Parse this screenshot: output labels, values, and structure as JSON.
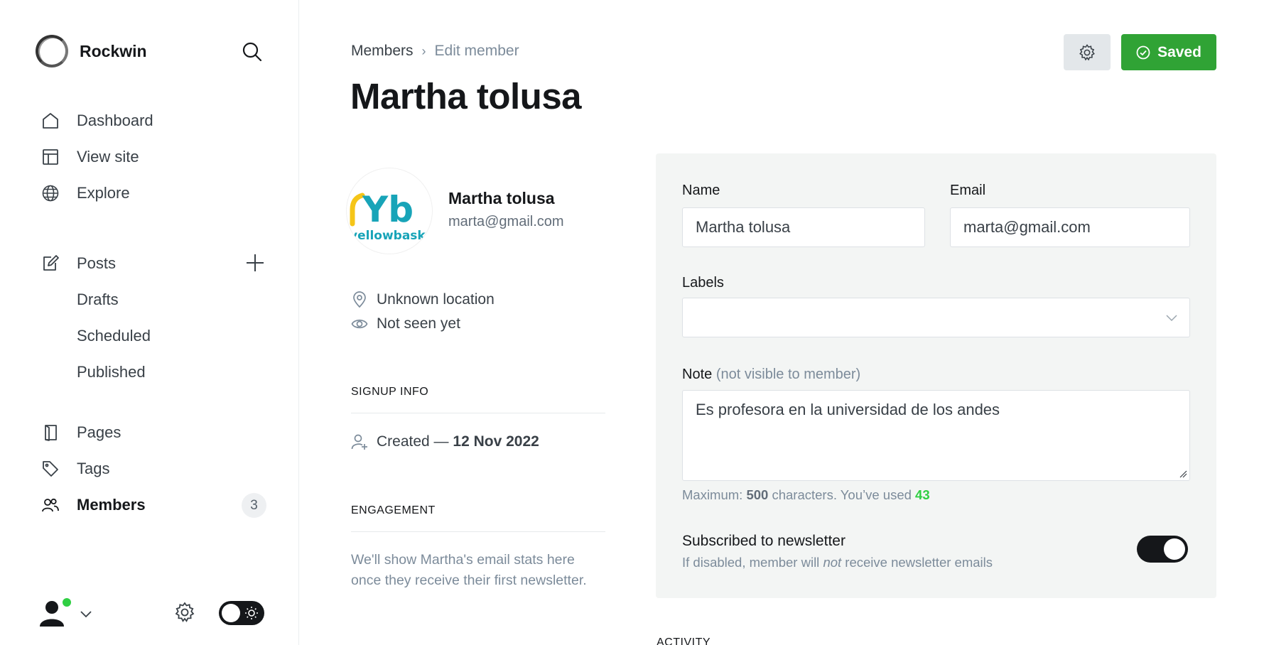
{
  "sidebar": {
    "brand": "Rockwin",
    "nav_primary": [
      {
        "label": "Dashboard",
        "icon": "home-icon"
      },
      {
        "label": "View site",
        "icon": "layout-icon"
      },
      {
        "label": "Explore",
        "icon": "globe-icon"
      }
    ],
    "posts": {
      "label": "Posts",
      "icon": "edit-icon"
    },
    "post_subitems": [
      "Drafts",
      "Scheduled",
      "Published"
    ],
    "nav_secondary": [
      {
        "label": "Pages",
        "icon": "page-icon"
      },
      {
        "label": "Tags",
        "icon": "tag-icon"
      },
      {
        "label": "Members",
        "icon": "members-icon",
        "active": true,
        "count": "3"
      }
    ],
    "status_color": "#30cf43"
  },
  "header": {
    "breadcrumb": {
      "parent": "Members",
      "current": "Edit member"
    },
    "title": "Martha tolusa",
    "saved_label": "Saved",
    "saved_color": "#30a335"
  },
  "profile": {
    "name": "Martha tolusa",
    "email": "marta@gmail.com",
    "avatar_text": "Yb",
    "avatar_caption": "yellowbasket.i",
    "location": "Unknown location",
    "seen": "Not seen yet",
    "signup_heading": "SIGNUP INFO",
    "created_prefix": "Created —",
    "created_date": "12 Nov 2022",
    "engagement_heading": "ENGAGEMENT",
    "engagement_text": "We'll show Martha's email stats here once they receive their first newsletter."
  },
  "form": {
    "name_label": "Name",
    "name_value": "Martha tolusa",
    "email_label": "Email",
    "email_value": "marta@gmail.com",
    "labels_label": "Labels",
    "note_label": "Note",
    "note_hint": "(not visible to member)",
    "note_value": "Es profesora en la universidad de los andes",
    "max_prefix": "Maximum:",
    "max_value": "500",
    "max_mid": "characters. You’ve used",
    "used_value": "43",
    "newsletter_title": "Subscribed to newsletter",
    "newsletter_sub_a": "If disabled, member will",
    "newsletter_sub_em": "not",
    "newsletter_sub_b": "receive newsletter emails",
    "newsletter_on": true
  },
  "activity_heading": "ACTIVITY"
}
